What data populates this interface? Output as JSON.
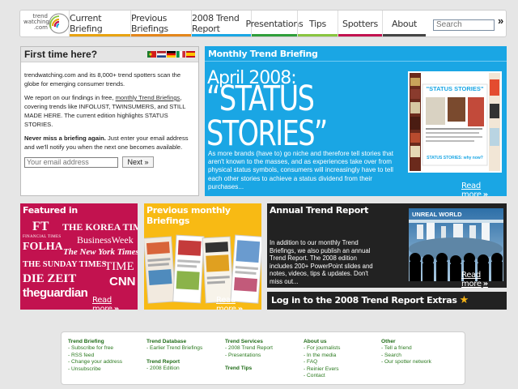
{
  "logo": {
    "line1": "trend",
    "line2": "watching",
    "line3": ".com"
  },
  "nav": {
    "items": [
      {
        "label": "Current Briefing",
        "color": "#e8a312"
      },
      {
        "label": "Previous Briefings",
        "color": "#e4861b"
      },
      {
        "label": "2008 Trend Report",
        "color": "#1aa6e4"
      },
      {
        "label": "Presentations",
        "color": "#2f9e3a"
      },
      {
        "label": "Tips",
        "color": "#89c540"
      },
      {
        "label": "Spotters",
        "color": "#c2124f"
      },
      {
        "label": "About",
        "color": "#444444"
      }
    ],
    "search_placeholder": "Search",
    "search_go": "»"
  },
  "first_time": {
    "title": "First time here?",
    "p1": "trendwatching.com and its 8,000+ trend spotters scan the globe for emerging consumer trends.",
    "p2_before": "We report on our findings in free,",
    "p2_link": "monthly Trend Briefings",
    "p2_after": ", covering trends like INFOLUST, TWINSUMERS, and STILL MADE HERE. The current edition highlights STATUS STORIES.",
    "p3_bold": "Never miss a briefing again.",
    "p3_rest": " Just enter your email address and we'll notify you when the next one becomes available.",
    "email_placeholder": "Your email address",
    "next_label": "Next »"
  },
  "monthly": {
    "title": "Monthly Trend Briefing",
    "date": "April 2008:",
    "headline_1": "“STATUS",
    "headline_2": "STORIES”",
    "description": "As more brands (have to) go niche and therefore tell stories that aren't known to the masses, and as experiences take over from physical status symbols, consumers will increasingly have to tell each other stories to achieve a status dividend from their purchases...",
    "read_more": "Read more",
    "thumb_title": "\"STATUS STORIES\"",
    "thumb_caption": "STATUS STORIES: why now?"
  },
  "featured": {
    "title": "Featured in",
    "publications": [
      "FT",
      "FINANCIAL TIMES",
      "THE KOREA TIMES",
      "BusinessWeek",
      "FOLHA",
      "The New York Times",
      "THE SUNDAY TIMES",
      "TIME",
      "DIE ZEIT",
      "CNN",
      "theguardian"
    ],
    "read_more": "Read more"
  },
  "previous": {
    "title": "Previous monthly Briefings",
    "read_more": "Read more"
  },
  "annual": {
    "title": "Annual Trend Report",
    "description": "In addition to our monthly Trend Briefings, we also publish an annual Trend Report. The 2008 edition includes 200+ PowerPoint slides and notes, videos, tips & updates. Don't miss out...",
    "image_label": "UNREAL WORLD",
    "read_more": "Read more"
  },
  "login": {
    "label": "Log in to the 2008 Trend Report Extras"
  },
  "footer": {
    "columns": [
      {
        "heading": "Trend Briefing",
        "links": [
          "- Subscribe for free",
          "- RSS feed",
          "- Change your address",
          "- Unsubscribe"
        ]
      },
      {
        "heading": "Trend Database",
        "links": [
          "- Earlier Trend Briefings"
        ],
        "heading2": "Trend Report",
        "links2": [
          "- 2008 Edition"
        ]
      },
      {
        "heading": "Trend Services",
        "links": [
          "- 2008 Trend Report",
          "- Presentations"
        ],
        "heading2": "Trend Tips",
        "links2": []
      },
      {
        "heading": "About us",
        "links": [
          "- For journalists",
          "- In the media",
          "- FAQ",
          "- Reinier Evers",
          "- Contact"
        ]
      },
      {
        "heading": "Other",
        "links": [
          "- Tell a friend",
          "- Search",
          "- Our spotter network"
        ]
      }
    ]
  }
}
